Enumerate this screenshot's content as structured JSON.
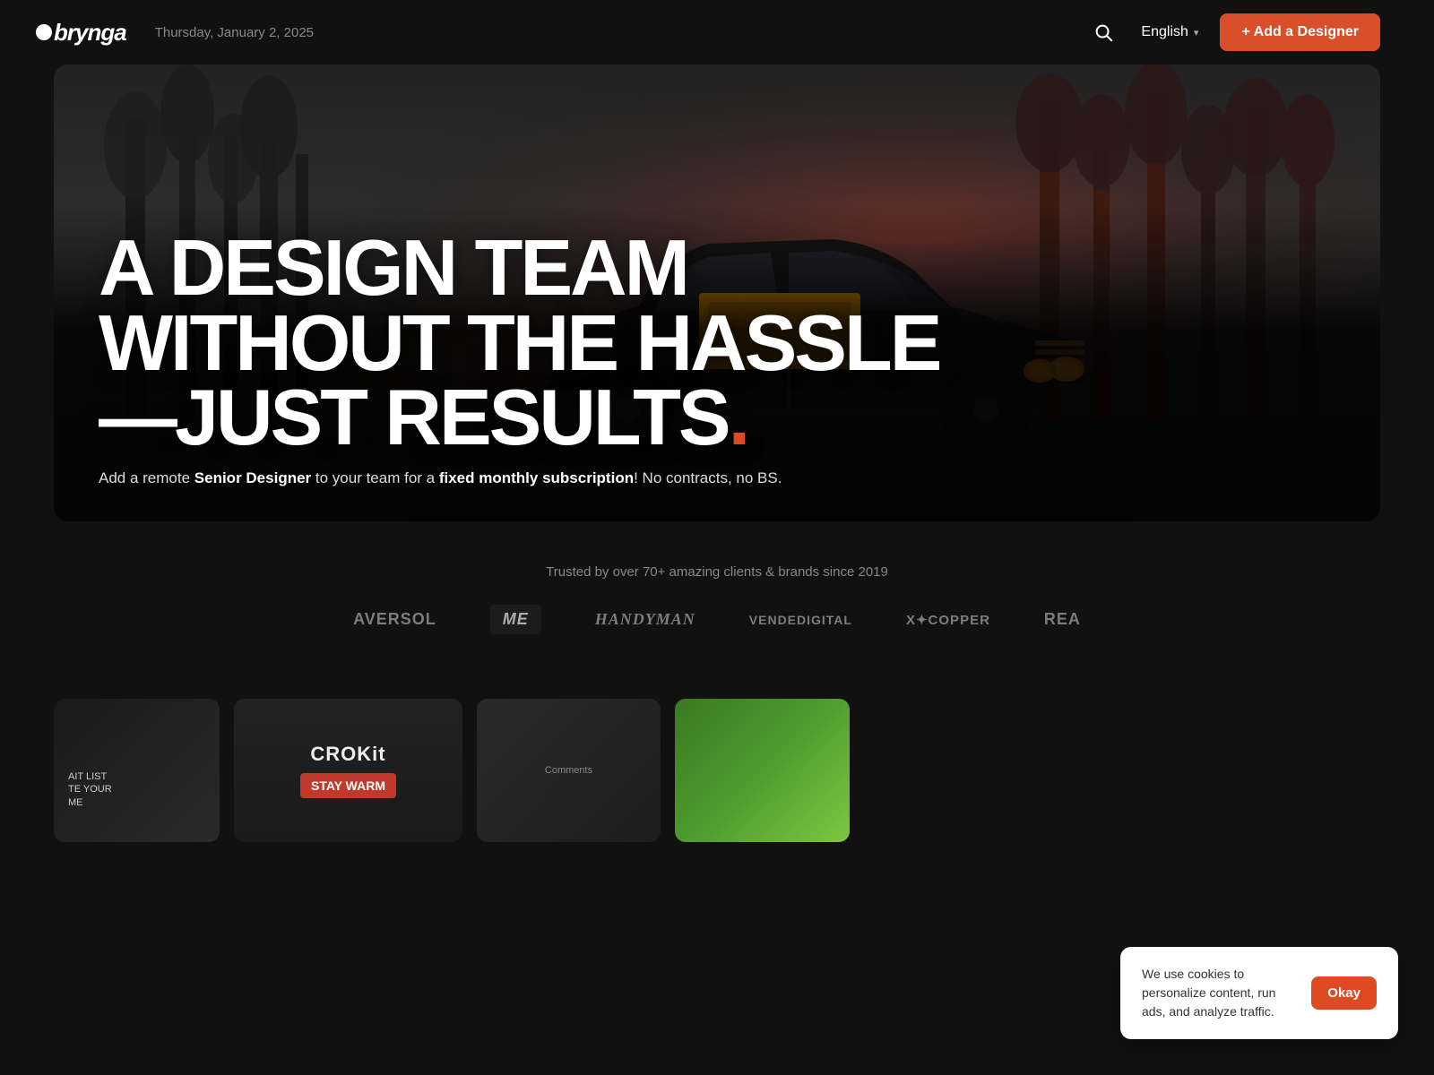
{
  "header": {
    "logo": "brynga",
    "date": "Thursday, January 2, 2025",
    "language": "English",
    "add_designer_label": "+ Add a Designer"
  },
  "hero": {
    "headline_line1": "A Design Team",
    "headline_line2": "Without the Hassle",
    "headline_line3": "—Just Results.",
    "subtext": "Add a remote Senior Designer to your team for a fixed monthly subscription! No contracts, no BS."
  },
  "trusted": {
    "label": "Trusted by over 70+ amazing clients & brands since 2019",
    "brands": [
      {
        "name": "AVERSOL",
        "style": "default"
      },
      {
        "name": "ME",
        "style": "styled-me"
      },
      {
        "name": "HandyMan",
        "style": "handyman"
      },
      {
        "name": "vendedigital",
        "style": "vende"
      },
      {
        "name": "X✦COPPER",
        "style": "copper"
      },
      {
        "name": "REA",
        "style": "rea"
      }
    ]
  },
  "cookie": {
    "text": "We use cookies to personalize content, run ads, and analyze traffic.",
    "okay_label": "Okay"
  }
}
